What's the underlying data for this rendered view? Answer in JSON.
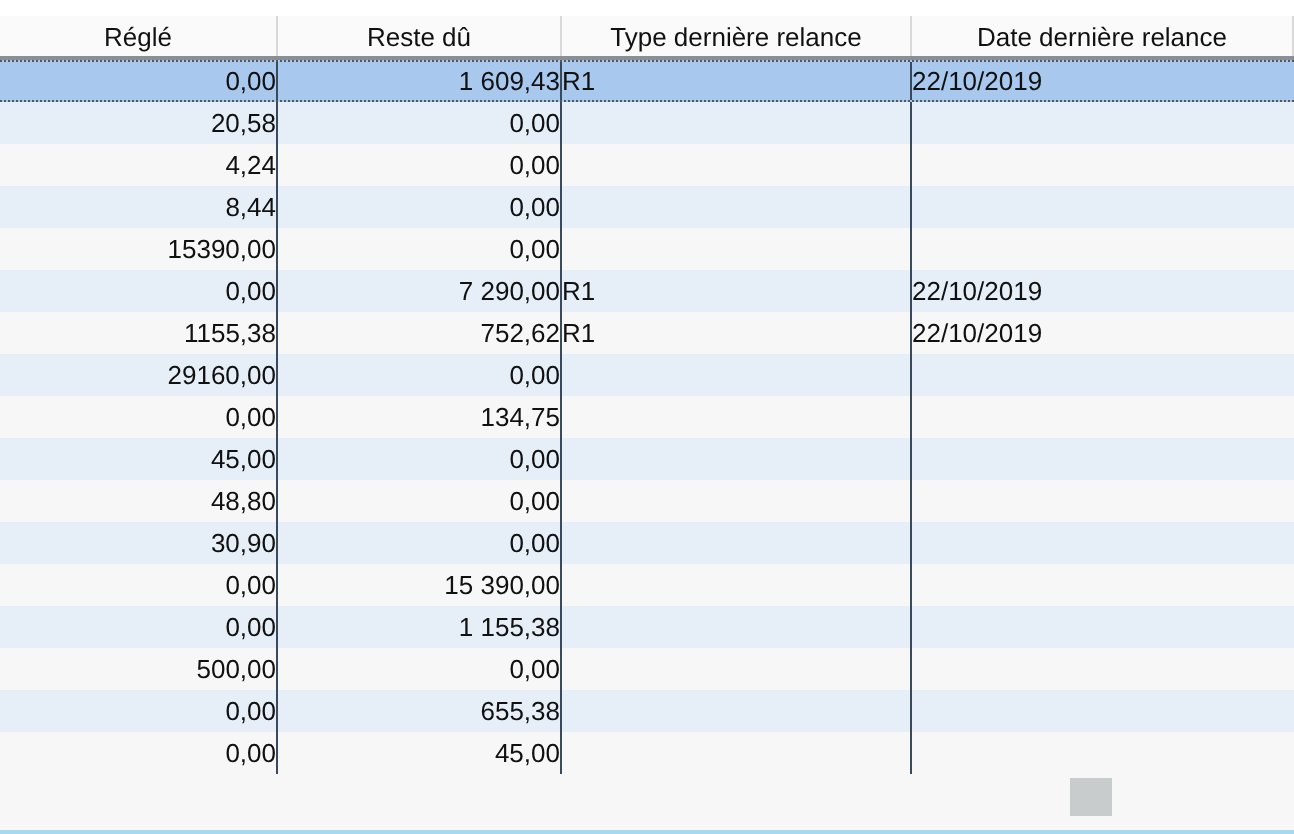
{
  "table": {
    "columns": [
      "Réglé",
      "Reste dû",
      "Type dernière relance",
      "Date dernière relance"
    ],
    "rows": [
      {
        "selected": true,
        "cells": [
          "0,00",
          "1 609,43",
          "R1",
          "22/10/2019"
        ]
      },
      {
        "selected": false,
        "cells": [
          "20,58",
          "0,00",
          "",
          ""
        ]
      },
      {
        "selected": false,
        "cells": [
          "4,24",
          "0,00",
          "",
          ""
        ]
      },
      {
        "selected": false,
        "cells": [
          "8,44",
          "0,00",
          "",
          ""
        ]
      },
      {
        "selected": false,
        "cells": [
          "15390,00",
          "0,00",
          "",
          ""
        ]
      },
      {
        "selected": false,
        "cells": [
          "0,00",
          "7 290,00",
          "R1",
          "22/10/2019"
        ]
      },
      {
        "selected": false,
        "cells": [
          "1155,38",
          "752,62",
          "R1",
          "22/10/2019"
        ]
      },
      {
        "selected": false,
        "cells": [
          "29160,00",
          "0,00",
          "",
          ""
        ]
      },
      {
        "selected": false,
        "cells": [
          "0,00",
          "134,75",
          "",
          ""
        ]
      },
      {
        "selected": false,
        "cells": [
          "45,00",
          "0,00",
          "",
          ""
        ]
      },
      {
        "selected": false,
        "cells": [
          "48,80",
          "0,00",
          "",
          ""
        ]
      },
      {
        "selected": false,
        "cells": [
          "30,90",
          "0,00",
          "",
          ""
        ]
      },
      {
        "selected": false,
        "cells": [
          "0,00",
          "15 390,00",
          "",
          ""
        ]
      },
      {
        "selected": false,
        "cells": [
          "0,00",
          "1 155,38",
          "",
          ""
        ]
      },
      {
        "selected": false,
        "cells": [
          "500,00",
          "0,00",
          "",
          ""
        ]
      },
      {
        "selected": false,
        "cells": [
          "0,00",
          "655,38",
          "",
          ""
        ]
      },
      {
        "selected": false,
        "cells": [
          "0,00",
          "45,00",
          "",
          ""
        ]
      }
    ]
  }
}
